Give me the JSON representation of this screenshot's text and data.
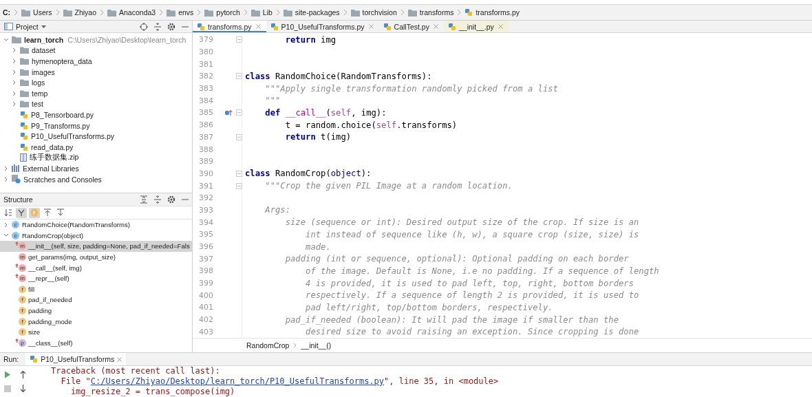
{
  "breadcrumb": [
    {
      "label": "C:",
      "kind": "drive"
    },
    {
      "label": "Users",
      "kind": "folder"
    },
    {
      "label": "Zhiyao",
      "kind": "folder"
    },
    {
      "label": "Anaconda3",
      "kind": "folder"
    },
    {
      "label": "envs",
      "kind": "folder"
    },
    {
      "label": "pytorch",
      "kind": "folder"
    },
    {
      "label": "Lib",
      "kind": "folder"
    },
    {
      "label": "site-packages",
      "kind": "folder"
    },
    {
      "label": "torchvision",
      "kind": "folder"
    },
    {
      "label": "transforms",
      "kind": "folder"
    },
    {
      "label": "transforms.py",
      "kind": "file"
    }
  ],
  "project_panel": {
    "title": "Project",
    "tree": [
      {
        "label": "learn_torch",
        "path": "C:\\Users\\Zhiyao\\Desktop\\learn_torch",
        "kind": "root",
        "expanded": true,
        "children": [
          {
            "label": "dataset",
            "kind": "folder",
            "expanded": false
          },
          {
            "label": "hymenoptera_data",
            "kind": "folder",
            "expanded": false
          },
          {
            "label": "images",
            "kind": "folder",
            "expanded": false
          },
          {
            "label": "logs",
            "kind": "folder",
            "expanded": false
          },
          {
            "label": "temp",
            "kind": "folder",
            "expanded": false
          },
          {
            "label": "test",
            "kind": "folder",
            "expanded": false
          },
          {
            "label": "P8_Tensorboard.py",
            "kind": "python"
          },
          {
            "label": "P9_Transforms.py",
            "kind": "python"
          },
          {
            "label": "P10_UsefulTransforms.py",
            "kind": "python"
          },
          {
            "label": "read_data.py",
            "kind": "python"
          },
          {
            "label": "练手数据集.zip",
            "kind": "archive"
          }
        ]
      },
      {
        "label": "External Libraries",
        "kind": "libraries",
        "expanded": false
      },
      {
        "label": "Scratches and Consoles",
        "kind": "scratches",
        "expanded": false
      }
    ]
  },
  "structure_panel": {
    "title": "Structure",
    "toolbar": [
      {
        "kind": "sort",
        "on": false
      },
      {
        "kind": "inherited",
        "on": true
      },
      {
        "kind": "fields",
        "on": true
      },
      {
        "kind": "expand",
        "on": false
      },
      {
        "kind": "collapse",
        "on": false
      }
    ],
    "items": [
      {
        "label": "RandomChoice(RandomTransforms)",
        "letter": "c",
        "kind": "class",
        "expanded": false,
        "selected": false
      },
      {
        "label": "RandomCrop(object)",
        "letter": "c",
        "kind": "class",
        "expanded": true,
        "selected": false,
        "children": [
          {
            "label": "__init__(self, size, padding=None, pad_if_needed=Fals",
            "letter": "m",
            "kind": "method",
            "override": true,
            "selected": true
          },
          {
            "label": "get_params(img, output_size)",
            "letter": "m",
            "kind": "method",
            "override": false,
            "selected": false
          },
          {
            "label": "__call__(self, img)",
            "letter": "m",
            "kind": "method",
            "override": true,
            "selected": false
          },
          {
            "label": "__repr__(self)",
            "letter": "m",
            "kind": "method",
            "override": true,
            "selected": false
          },
          {
            "label": "fill",
            "letter": "f",
            "kind": "field",
            "override": false,
            "selected": false
          },
          {
            "label": "pad_if_needed",
            "letter": "f",
            "kind": "field",
            "override": false,
            "selected": false
          },
          {
            "label": "padding",
            "letter": "f",
            "kind": "field",
            "override": false,
            "selected": false
          },
          {
            "label": "padding_mode",
            "letter": "f",
            "kind": "field",
            "override": false,
            "selected": false
          },
          {
            "label": "size",
            "letter": "f",
            "kind": "field",
            "override": false,
            "selected": false
          },
          {
            "label": "__class__(self)",
            "letter": "p",
            "kind": "property",
            "override": true,
            "selected": false
          }
        ]
      }
    ]
  },
  "editor": {
    "tabs": [
      {
        "label": "transforms.py",
        "selected": true
      },
      {
        "label": "P10_UsefulTransforms.py",
        "selected": false
      },
      {
        "label": "CallTest.py",
        "selected": false
      },
      {
        "label": "__init__.py",
        "selected": false
      }
    ],
    "lines": [
      {
        "num": "379",
        "fold": true,
        "override": false,
        "segments": [
          {
            "text": "        return",
            "kind": "kw"
          },
          {
            "text": " img",
            "kind": "plain"
          }
        ]
      },
      {
        "num": "380",
        "fold": false,
        "override": false
      },
      {
        "num": "381",
        "fold": false,
        "override": false
      },
      {
        "num": "382",
        "fold": true,
        "override": false,
        "segments": [
          {
            "text": "class",
            "kind": "kw"
          },
          {
            "text": " RandomChoice(RandomTransforms):",
            "kind": "plain"
          }
        ]
      },
      {
        "num": "383",
        "fold": false,
        "override": false,
        "segments": [
          {
            "text": "    \"\"\"Apply single transformation randomly picked from a list",
            "kind": "doc"
          }
        ]
      },
      {
        "num": "384",
        "fold": false,
        "override": false,
        "segments": [
          {
            "text": "    \"\"\"",
            "kind": "doc"
          }
        ]
      },
      {
        "num": "385",
        "fold": true,
        "override": true,
        "segments": [
          {
            "text": "    def",
            "kind": "kw"
          },
          {
            "text": " __call__",
            "kind": "magic"
          },
          {
            "text": "(",
            "kind": "plain"
          },
          {
            "text": "self",
            "kind": "self"
          },
          {
            "text": ", img):",
            "kind": "plain"
          }
        ]
      },
      {
        "num": "386",
        "fold": false,
        "override": false,
        "segments": [
          {
            "text": "        t = random.choice(",
            "kind": "plain"
          },
          {
            "text": "self",
            "kind": "self"
          },
          {
            "text": ".transforms)",
            "kind": "plain"
          }
        ]
      },
      {
        "num": "387",
        "fold": true,
        "override": false,
        "segments": [
          {
            "text": "        return",
            "kind": "kw"
          },
          {
            "text": " t(img)",
            "kind": "plain"
          }
        ]
      },
      {
        "num": "388",
        "fold": false,
        "override": false
      },
      {
        "num": "389",
        "fold": false,
        "override": false
      },
      {
        "num": "390",
        "fold": true,
        "override": false,
        "segments": [
          {
            "text": "class",
            "kind": "kw"
          },
          {
            "text": " RandomCrop(",
            "kind": "plain"
          },
          {
            "text": "object",
            "kind": "builtin"
          },
          {
            "text": "):",
            "kind": "plain"
          }
        ]
      },
      {
        "num": "391",
        "fold": true,
        "override": false,
        "segments": [
          {
            "text": "    \"\"\"Crop the given PIL Image at a random location.",
            "kind": "doc"
          }
        ]
      },
      {
        "num": "392",
        "fold": false,
        "override": false
      },
      {
        "num": "393",
        "fold": false,
        "override": false,
        "segments": [
          {
            "text": "    Args:",
            "kind": "doc"
          }
        ]
      },
      {
        "num": "394",
        "fold": false,
        "override": false,
        "segments": [
          {
            "text": "        size (sequence or int): Desired output size of the crop. If size is an",
            "kind": "doc"
          }
        ]
      },
      {
        "num": "395",
        "fold": false,
        "override": false,
        "segments": [
          {
            "text": "            int instead of sequence like (h, w), a square crop (size, size) is",
            "kind": "doc"
          }
        ]
      },
      {
        "num": "396",
        "fold": false,
        "override": false,
        "segments": [
          {
            "text": "            made.",
            "kind": "doc"
          }
        ]
      },
      {
        "num": "397",
        "fold": false,
        "override": false,
        "segments": [
          {
            "text": "        padding (int or sequence, optional): Optional padding on each border",
            "kind": "doc"
          }
        ]
      },
      {
        "num": "398",
        "fold": false,
        "override": false,
        "segments": [
          {
            "text": "            of the image. Default is None, i.e no padding. If a sequence of length",
            "kind": "doc"
          }
        ]
      },
      {
        "num": "399",
        "fold": false,
        "override": false,
        "segments": [
          {
            "text": "            4 is provided, it is used to pad left, top, right, bottom borders",
            "kind": "doc"
          }
        ]
      },
      {
        "num": "400",
        "fold": false,
        "override": false,
        "segments": [
          {
            "text": "            respectively. If a sequence of length 2 is provided, it is used to",
            "kind": "doc"
          }
        ]
      },
      {
        "num": "401",
        "fold": false,
        "override": false,
        "segments": [
          {
            "text": "            pad left/right, top/bottom borders, respectively.",
            "kind": "doc"
          }
        ]
      },
      {
        "num": "402",
        "fold": false,
        "override": false,
        "segments": [
          {
            "text": "        pad_if_needed (boolean): It will pad the image if smaller than the",
            "kind": "doc"
          }
        ]
      },
      {
        "num": "403",
        "fold": false,
        "override": false,
        "segments": [
          {
            "text": "            desired size to avoid raising an exception. Since cropping is done",
            "kind": "doc"
          }
        ]
      }
    ],
    "breadcrumb": [
      "RandomCrop",
      "__init__()"
    ]
  },
  "run_panel": {
    "label": "Run:",
    "tab": "P10_UsefulTransforms",
    "console": [
      [
        {
          "text": "Traceback (most recent call last):",
          "kind": "text"
        }
      ],
      [
        {
          "text": "  File \"",
          "kind": "text"
        },
        {
          "text": "C:/Users/Zhiyao/Desktop/learn_torch/P10_UsefulTransforms.py",
          "kind": "link"
        },
        {
          "text": "\", line 35, in <module>",
          "kind": "text"
        }
      ],
      [
        {
          "text": "    img_resize_2 = trans_compose(img)",
          "kind": "text"
        }
      ]
    ]
  }
}
